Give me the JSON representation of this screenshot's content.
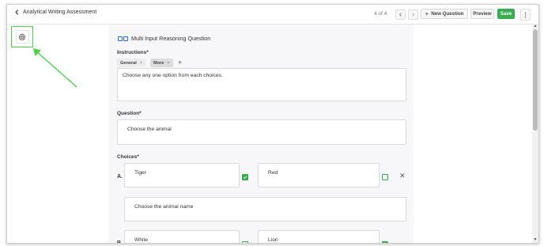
{
  "header": {
    "back_title": "Analytical Writing Assessment",
    "counter": "4 of 4",
    "new_question_label": "New Question",
    "preview_label": "Preview",
    "save_label": "Save"
  },
  "editor": {
    "question_type": "Multi Input Reasoning Question",
    "instructions_label": "Instructions*",
    "tags": [
      "General",
      "More"
    ],
    "instructions_text": "Choose any one option from each choices.",
    "question_label": "Question*",
    "question_text": "Choose the animal",
    "choices_label": "Choices*",
    "choices": [
      {
        "letter": "A.",
        "option1": "Tiger",
        "option1_checked": true,
        "option2": "Red",
        "option2_checked": false,
        "sub_question": "Choose the animal name"
      },
      {
        "letter": "B.",
        "option1": "White",
        "option1_checked": false,
        "option2": "Lion",
        "option2_checked": true
      }
    ]
  },
  "colors": {
    "accent_green": "#3aac50",
    "highlight_green": "#4cd04c",
    "link_blue": "#2a6ccf"
  },
  "icons": [
    "chevron-left-icon",
    "chevron-right-icon",
    "plus-icon",
    "kebab-icon",
    "gear-icon",
    "check-icon",
    "close-icon"
  ]
}
